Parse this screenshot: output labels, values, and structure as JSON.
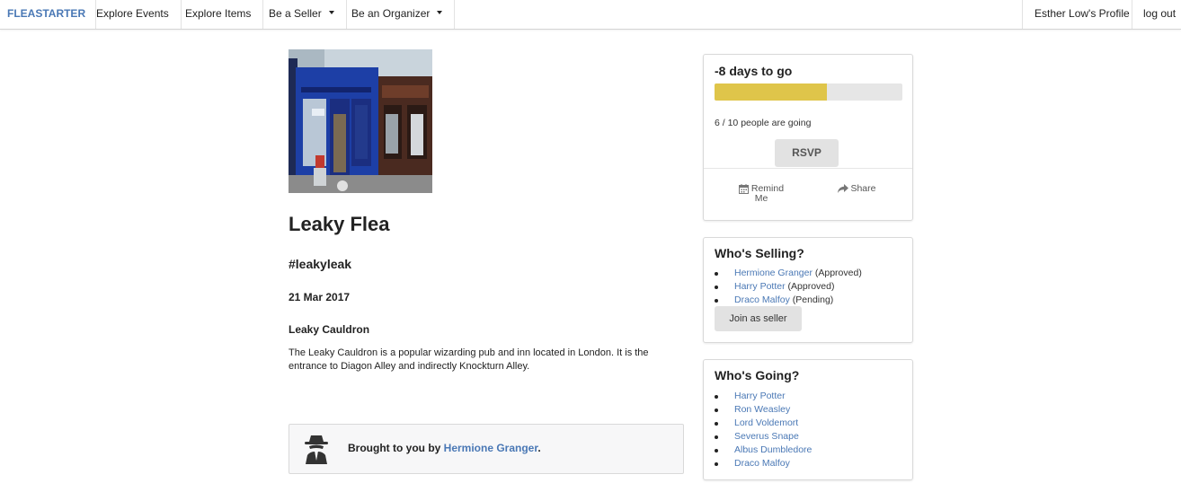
{
  "nav": {
    "brand": "FLEASTARTER",
    "explore_events": "Explore Events",
    "explore_items": "Explore Items",
    "be_seller": "Be a Seller",
    "be_organizer": "Be an Organizer",
    "profile": "Esther Low's Profile",
    "logout": "log out"
  },
  "event": {
    "title": "Leaky Flea",
    "hashtag": "#leakyleak",
    "date": "21 Mar 2017",
    "venue": "Leaky Cauldron",
    "description": "The Leaky Cauldron is a popular wizarding pub and inn located in London. It is the entrance to Diagon Alley and indirectly Knockturn Alley.",
    "organizer_prefix": "Brought to you by ",
    "organizer_name": "Hermione Granger",
    "organizer_suffix": "."
  },
  "rsvp_panel": {
    "days_to_go": "-8 days to go",
    "going_text": "6 / 10 people are going",
    "progress_fraction": 0.6,
    "progress_color": "#dfc54a",
    "rsvp_label": "RSVP",
    "remind_line1": "Remind",
    "remind_line2": "Me",
    "share_label": "Share",
    "remind_icon": "calendar-icon",
    "share_icon": "share-icon"
  },
  "selling_panel": {
    "title": "Who's Selling?",
    "sellers": [
      {
        "name": "Hermione Granger",
        "status": "(Approved)"
      },
      {
        "name": "Harry Potter",
        "status": "(Approved)"
      },
      {
        "name": "Draco Malfoy",
        "status": "(Pending)"
      }
    ],
    "join_label": "Join as seller"
  },
  "going_panel": {
    "title": "Who's Going?",
    "attendees": [
      "Harry Potter",
      "Ron Weasley",
      "Lord Voldemort",
      "Severus Snape",
      "Albus Dumbledore",
      "Draco Malfoy"
    ]
  },
  "colors": {
    "link": "#4a78b5",
    "brand": "#4a78b5"
  }
}
